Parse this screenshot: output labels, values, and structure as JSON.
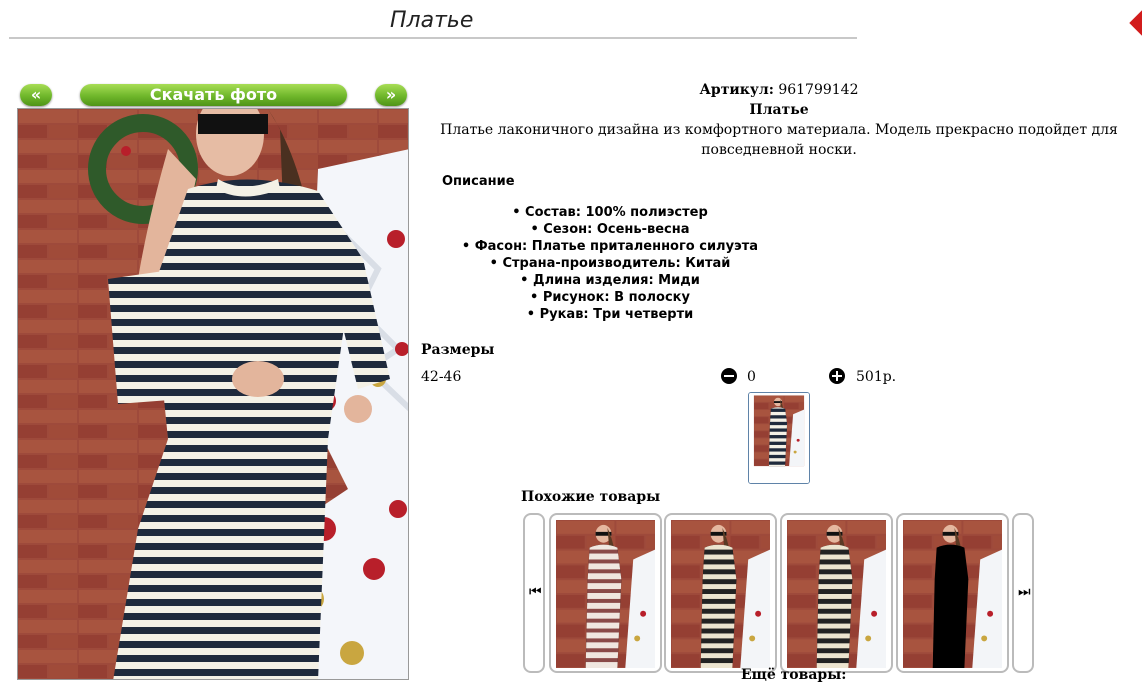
{
  "header": {
    "title": "Платье"
  },
  "photo_controls": {
    "prev_label": "«",
    "download_label": "Скачать фото",
    "next_label": "»"
  },
  "product": {
    "article_label": "Артикул:",
    "article_value": "961799142",
    "name": "Платье",
    "description": "Платье лаконичного дизайна из комфортного материала. Модель прекрасно подойдет для повседневной носки."
  },
  "description_block": {
    "heading": "Описание",
    "properties": [
      "Состав: 100% полиэстер",
      "Сезон: Осень-весна",
      "Фасон: Платье приталенного силуэта",
      "Страна-производитель: Китай",
      "Длина изделия: Миди",
      "Рисунок: В полоску",
      "Рукав: Три четверти"
    ]
  },
  "sizes": {
    "heading": "Размеры",
    "rows": [
      {
        "size": "42-46",
        "quantity": "0",
        "price": "501р."
      }
    ]
  },
  "similar": {
    "heading": "Похожие товары",
    "items": [
      {
        "variant": "red-stripe"
      },
      {
        "variant": "beige-stripe"
      },
      {
        "variant": "beige-stripe"
      },
      {
        "variant": "black"
      }
    ]
  },
  "more": {
    "heading": "Ещё товары:"
  },
  "colors": {
    "button_green": "#6fb72b",
    "brick": "#9e4a3b",
    "stripe_dark": "#1f2a3c",
    "stripe_light": "#f4f1e6",
    "accent_red": "#d21c1c"
  },
  "icons": {
    "decrease": "minus-circle-icon",
    "increase": "plus-circle-icon",
    "carousel_prev": "skip-back-icon",
    "carousel_next": "skip-forward-icon"
  }
}
